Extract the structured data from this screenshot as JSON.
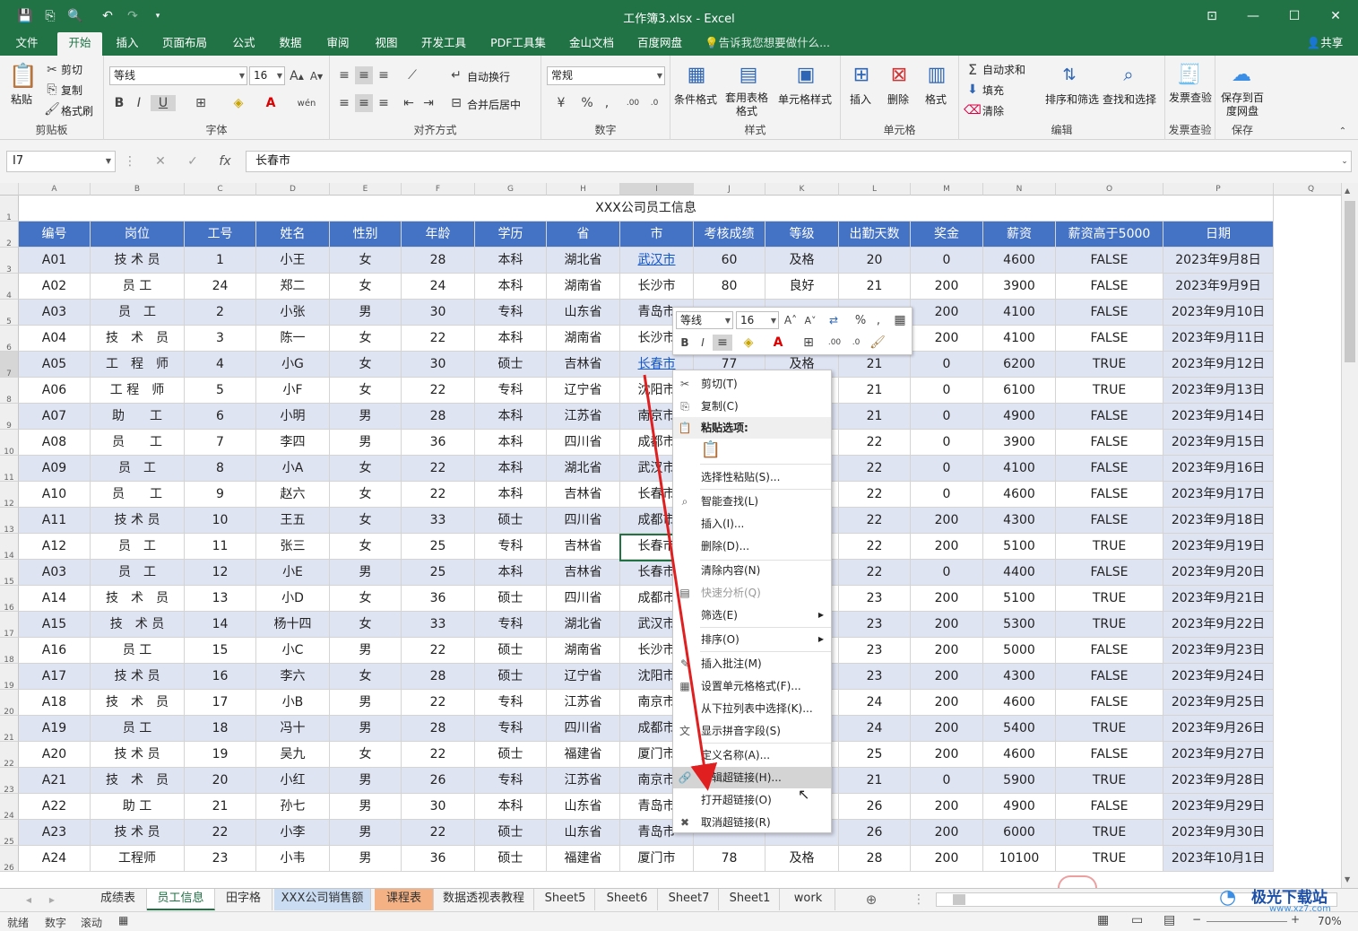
{
  "app": {
    "title": "工作簿3.xlsx - Excel",
    "share": "共享",
    "tell_me": "告诉我您想要做什么..."
  },
  "tabs": [
    "文件",
    "开始",
    "插入",
    "页面布局",
    "公式",
    "数据",
    "审阅",
    "视图",
    "开发工具",
    "PDF工具集",
    "金山文档",
    "百度网盘"
  ],
  "ribbon": {
    "clipboard": {
      "paste": "粘贴",
      "cut": "剪切",
      "copy": "复制",
      "format_painter": "格式刷",
      "label": "剪贴板"
    },
    "font": {
      "name": "等线",
      "size": "16",
      "bold": "B",
      "italic": "I",
      "underline": "U",
      "label": "字体"
    },
    "align": {
      "wrap": "自动换行",
      "merge": "合并后居中",
      "label": "对齐方式"
    },
    "number": {
      "format": "常规",
      "label": "数字"
    },
    "styles": {
      "cond": "条件格式",
      "table": "套用表格格式",
      "cell": "单元格样式",
      "label": "样式"
    },
    "cells": {
      "insert": "插入",
      "delete": "删除",
      "format": "格式",
      "label": "单元格"
    },
    "edit": {
      "autosum": "自动求和",
      "fill": "填充",
      "clear": "清除",
      "sort": "排序和筛选",
      "find": "查找和选择",
      "label": "编辑"
    },
    "check": {
      "btn": "发票查验",
      "label": "发票查验"
    },
    "save": {
      "btn": "保存到百度网盘",
      "label": "保存"
    }
  },
  "formula_bar": {
    "name_box": "I7",
    "value": "长春市"
  },
  "columns": [
    "A",
    "B",
    "C",
    "D",
    "E",
    "F",
    "G",
    "H",
    "I",
    "J",
    "K",
    "L",
    "M",
    "N",
    "O",
    "P",
    "Q"
  ],
  "sheet_title": "XXX公司员工信息",
  "headers": [
    "编号",
    "岗位",
    "工号",
    "姓名",
    "性别",
    "年龄",
    "学历",
    "省",
    "市",
    "考核成绩",
    "等级",
    "出勤天数",
    "奖金",
    "薪资",
    "薪资高于5000",
    "日期"
  ],
  "rows": [
    [
      "A01",
      "技 术 员",
      "1",
      "小王",
      "女",
      "28",
      "本科",
      "湖北省",
      "武汉市",
      "60",
      "及格",
      "20",
      "0",
      "4600",
      "FALSE",
      "2023年9月8日"
    ],
    [
      "A02",
      "员 工",
      "24",
      "郑二",
      "女",
      "24",
      "本科",
      "湖南省",
      "长沙市",
      "80",
      "良好",
      "21",
      "200",
      "3900",
      "FALSE",
      "2023年9月9日"
    ],
    [
      "A03",
      "员　工",
      "2",
      "小张",
      "男",
      "30",
      "专科",
      "山东省",
      "青岛市",
      "",
      "",
      "",
      "200",
      "4100",
      "FALSE",
      "2023年9月10日"
    ],
    [
      "A04",
      "技　术　员",
      "3",
      "陈一",
      "女",
      "22",
      "本科",
      "湖南省",
      "长沙市",
      "",
      "",
      "",
      "200",
      "4100",
      "FALSE",
      "2023年9月11日"
    ],
    [
      "A05",
      "工　程　师",
      "4",
      "小G",
      "女",
      "30",
      "硕士",
      "吉林省",
      "长春市",
      "77",
      "及格",
      "21",
      "0",
      "6200",
      "TRUE",
      "2023年9月12日"
    ],
    [
      "A06",
      "工 程　师",
      "5",
      "小F",
      "女",
      "22",
      "专科",
      "辽宁省",
      "沈阳市",
      "",
      "",
      "21",
      "0",
      "6100",
      "TRUE",
      "2023年9月13日"
    ],
    [
      "A07",
      "助　　工",
      "6",
      "小明",
      "男",
      "28",
      "本科",
      "江苏省",
      "南京市",
      "",
      "",
      "21",
      "0",
      "4900",
      "FALSE",
      "2023年9月14日"
    ],
    [
      "A08",
      "员　　工",
      "7",
      "李四",
      "男",
      "36",
      "本科",
      "四川省",
      "成都市",
      "",
      "",
      "22",
      "0",
      "3900",
      "FALSE",
      "2023年9月15日"
    ],
    [
      "A09",
      "员　工",
      "8",
      "小A",
      "女",
      "22",
      "本科",
      "湖北省",
      "武汉市",
      "",
      "",
      "22",
      "0",
      "4100",
      "FALSE",
      "2023年9月16日"
    ],
    [
      "A10",
      "员　　工",
      "9",
      "赵六",
      "女",
      "22",
      "本科",
      "吉林省",
      "长春市",
      "",
      "",
      "22",
      "0",
      "4600",
      "FALSE",
      "2023年9月17日"
    ],
    [
      "A11",
      "技 术 员",
      "10",
      "王五",
      "女",
      "33",
      "硕士",
      "四川省",
      "成都市",
      "",
      "",
      "22",
      "200",
      "4300",
      "FALSE",
      "2023年9月18日"
    ],
    [
      "A12",
      "员　工",
      "11",
      "张三",
      "女",
      "25",
      "专科",
      "吉林省",
      "长春市",
      "",
      "",
      "22",
      "200",
      "5100",
      "TRUE",
      "2023年9月19日"
    ],
    [
      "A03",
      "员　工",
      "12",
      "小E",
      "男",
      "25",
      "本科",
      "吉林省",
      "长春市",
      "",
      "",
      "22",
      "0",
      "4400",
      "FALSE",
      "2023年9月20日"
    ],
    [
      "A14",
      "技　术　员",
      "13",
      "小D",
      "女",
      "36",
      "硕士",
      "四川省",
      "成都市",
      "",
      "",
      "23",
      "200",
      "5100",
      "TRUE",
      "2023年9月21日"
    ],
    [
      "A15",
      "技　术 员",
      "14",
      "杨十四",
      "女",
      "33",
      "专科",
      "湖北省",
      "武汉市",
      "",
      "",
      "23",
      "200",
      "5300",
      "TRUE",
      "2023年9月22日"
    ],
    [
      "A16",
      "员 工",
      "15",
      "小C",
      "男",
      "22",
      "硕士",
      "湖南省",
      "长沙市",
      "",
      "",
      "23",
      "200",
      "5000",
      "FALSE",
      "2023年9月23日"
    ],
    [
      "A17",
      "技 术 员",
      "16",
      "李六",
      "女",
      "28",
      "硕士",
      "辽宁省",
      "沈阳市",
      "",
      "",
      "23",
      "200",
      "4300",
      "FALSE",
      "2023年9月24日"
    ],
    [
      "A18",
      "技　术　员",
      "17",
      "小B",
      "男",
      "22",
      "专科",
      "江苏省",
      "南京市",
      "",
      "",
      "24",
      "200",
      "4600",
      "FALSE",
      "2023年9月25日"
    ],
    [
      "A19",
      "员 工",
      "18",
      "冯十",
      "男",
      "28",
      "专科",
      "四川省",
      "成都市",
      "",
      "",
      "24",
      "200",
      "5400",
      "TRUE",
      "2023年9月26日"
    ],
    [
      "A20",
      "技 术 员",
      "19",
      "吴九",
      "女",
      "22",
      "硕士",
      "福建省",
      "厦门市",
      "",
      "",
      "25",
      "200",
      "4600",
      "FALSE",
      "2023年9月27日"
    ],
    [
      "A21",
      "技　术　员",
      "20",
      "小红",
      "男",
      "26",
      "专科",
      "江苏省",
      "南京市",
      "",
      "",
      "21",
      "0",
      "5900",
      "TRUE",
      "2023年9月28日"
    ],
    [
      "A22",
      "助 工",
      "21",
      "孙七",
      "男",
      "30",
      "本科",
      "山东省",
      "青岛市",
      "",
      "",
      "26",
      "200",
      "4900",
      "FALSE",
      "2023年9月29日"
    ],
    [
      "A23",
      "技 术 员",
      "22",
      "小李",
      "男",
      "22",
      "硕士",
      "山东省",
      "青岛市",
      "",
      "",
      "26",
      "200",
      "6000",
      "TRUE",
      "2023年9月30日"
    ],
    [
      "A24",
      "工程师",
      "23",
      "小韦",
      "男",
      "36",
      "硕士",
      "福建省",
      "厦门市",
      "78",
      "及格",
      "28",
      "200",
      "10100",
      "TRUE",
      "2023年10月1日"
    ]
  ],
  "mini_toolbar": {
    "font": "等线",
    "size": "16"
  },
  "context_menu": [
    {
      "label": "剪切(T)",
      "icon": "scissors-icon"
    },
    {
      "label": "复制(C)",
      "icon": "copy-icon"
    },
    {
      "label": "粘贴选项:",
      "icon": "paste-icon"
    },
    {
      "label": "选择性粘贴(S)...",
      "icon": ""
    },
    {
      "label": "智能查找(L)",
      "icon": "search-icon"
    },
    {
      "label": "插入(I)...",
      "icon": ""
    },
    {
      "label": "删除(D)...",
      "icon": ""
    },
    {
      "label": "清除内容(N)",
      "icon": ""
    },
    {
      "label": "快速分析(Q)",
      "icon": "quick-analysis-icon"
    },
    {
      "label": "筛选(E)",
      "icon": ""
    },
    {
      "label": "排序(O)",
      "icon": ""
    },
    {
      "label": "插入批注(M)",
      "icon": "comment-icon"
    },
    {
      "label": "设置单元格格式(F)...",
      "icon": "format-cells-icon"
    },
    {
      "label": "从下拉列表中选择(K)...",
      "icon": ""
    },
    {
      "label": "显示拼音字段(S)",
      "icon": "phonetic-icon"
    },
    {
      "label": "定义名称(A)...",
      "icon": ""
    },
    {
      "label": "编辑超链接(H)...",
      "icon": "edit-link-icon"
    },
    {
      "label": "打开超链接(O)",
      "icon": ""
    },
    {
      "label": "取消超链接(R)",
      "icon": "remove-link-icon"
    }
  ],
  "sheet_tabs": [
    "成绩表",
    "员工信息",
    "田字格",
    "XXX公司销售额",
    "课程表",
    "数据透视表教程",
    "Sheet5",
    "Sheet6",
    "Sheet7",
    "Sheet1",
    "work"
  ],
  "status": {
    "ready": "就绪",
    "num": "数字",
    "scroll": "滚动",
    "zoom": "70%"
  },
  "watermark": {
    "name": "极光下载站",
    "url": "www.xz7.com"
  },
  "colors": {
    "excel_green": "#217346",
    "header_blue": "#4472c4",
    "band": "#dfe4f3",
    "arrow_red": "#e02020"
  }
}
